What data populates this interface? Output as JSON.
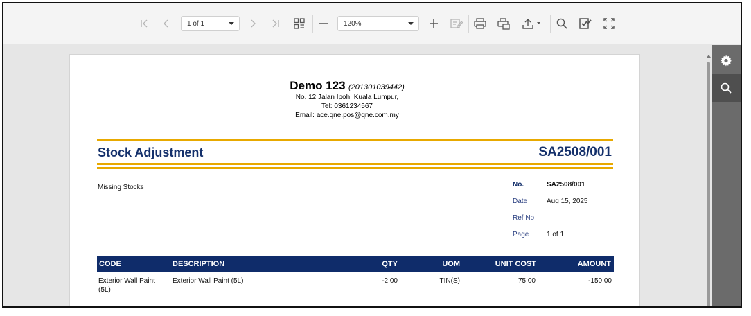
{
  "toolbar": {
    "page_selector": "1 of 1",
    "zoom": "120%",
    "icons": [
      "first-page-icon",
      "previous-page-icon",
      "next-page-icon",
      "last-page-icon",
      "thumbnails-icon",
      "zoom-out-icon",
      "zoom-in-icon",
      "edit-icon",
      "print-icon",
      "print-preview-icon",
      "export-icon",
      "search-icon",
      "parameters-icon",
      "fullscreen-icon"
    ]
  },
  "side_panel": {
    "icons": [
      "settings-gear-icon",
      "search-icon"
    ]
  },
  "company": {
    "name": "Demo 123",
    "registration": "(201301039442)",
    "address": "No. 12 Jalan Ipoh, Kuala Lumpur,",
    "tel": "Tel: 0361234567",
    "email": "Email: ace.qne.pos@qne.com.my"
  },
  "document": {
    "title": "Stock Adjustment",
    "number": "SA2508/001",
    "remark": "Missing Stocks",
    "accent_color": "#e8a900",
    "header_color": "#0f2c6a",
    "info": {
      "no_label": "No.",
      "no_value": "SA2508/001",
      "date_label": "Date",
      "date_value": "Aug 15, 2025",
      "ref_label": "Ref No",
      "ref_value": "",
      "page_label": "Page",
      "page_value": "1 of 1"
    }
  },
  "table": {
    "headers": {
      "code": "CODE",
      "description": "DESCRIPTION",
      "qty": "QTY",
      "uom": "UOM",
      "unit_cost": "UNIT COST",
      "amount": "AMOUNT"
    },
    "rows": [
      {
        "code_line1": "Exterior Wall Paint",
        "code_line2": "(5L)",
        "description": "Exterior Wall Paint (5L)",
        "qty": "-2.00",
        "uom": "TIN(S)",
        "unit_cost": "75.00",
        "amount": "-150.00"
      }
    ]
  }
}
